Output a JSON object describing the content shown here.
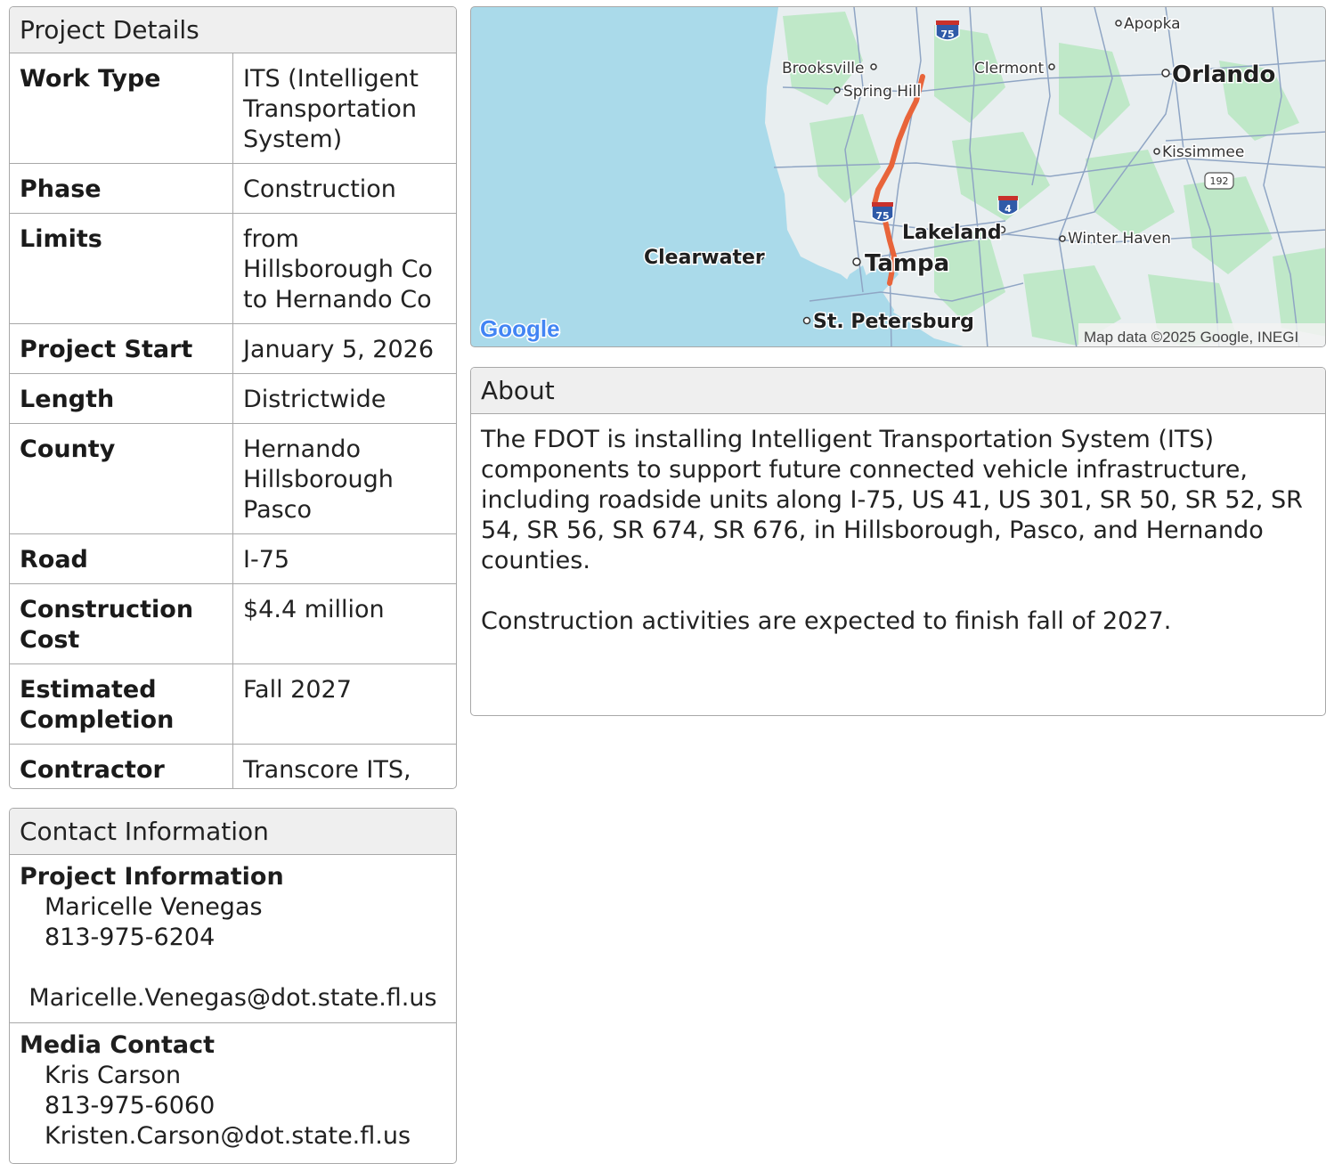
{
  "details": {
    "title": "Project Details",
    "rows": [
      {
        "key": "Work Type",
        "value": "ITS (Intelligent Transportation System)"
      },
      {
        "key": "Phase",
        "value": "Construction"
      },
      {
        "key": "Limits",
        "value": "from Hillsborough Co to Hernando Co"
      },
      {
        "key": "Project Start",
        "value": "January 5, 2026"
      },
      {
        "key": "Length",
        "value": "Districtwide"
      },
      {
        "key": "County",
        "value": "Hernando Hillsborough Pasco"
      },
      {
        "key": "Road",
        "value": "I-75"
      },
      {
        "key": "Construction Cost",
        "value": "$4.4 million"
      },
      {
        "key": "Estimated Completion",
        "value": "Fall 2027"
      },
      {
        "key": "Contractor",
        "value": "Transcore ITS, LLC"
      }
    ]
  },
  "contact": {
    "title": "Contact Information",
    "project": {
      "label": "Project Information",
      "name": "Maricelle Venegas",
      "phone": "813-975-6204",
      "email": "Maricelle.Venegas@dot.state.fl.us"
    },
    "media": {
      "label": "Media Contact",
      "name": "Kris Carson",
      "phone": "813-975-6060",
      "email": "Kristen.Carson@dot.state.fl.us"
    }
  },
  "map": {
    "cities": {
      "apopka": "Apopka",
      "brooksville": "Brooksville",
      "clermont": "Clermont",
      "orlando": "Orlando",
      "spring_hill": "Spring Hill",
      "kissimmee": "Kissimmee",
      "lakeland": "Lakeland",
      "winter_haven": "Winter Haven",
      "clearwater": "Clearwater",
      "tampa": "Tampa",
      "st_petersburg": "St. Petersburg"
    },
    "shields": {
      "i75": "75",
      "i4": "4",
      "us192": "192"
    },
    "google_logo": "Google",
    "attribution": "Map data ©2025 Google, INEGI",
    "colors": {
      "water": "#aadaea",
      "land": "#e8eef0",
      "park": "#bfe8c8",
      "route": "#e8643a",
      "road": "#8fa5c4"
    }
  },
  "about": {
    "title": "About",
    "paragraph1": "The FDOT is installing Intelligent Transportation System (ITS) components to support future connected vehicle infrastructure, including roadside units along I-75, US 41, US 301, SR 50, SR 52, SR 54, SR 56, SR 674, SR 676, in Hillsborough, Pasco, and Hernando counties.",
    "paragraph2": "Construction activities are expected to finish fall of 2027."
  }
}
